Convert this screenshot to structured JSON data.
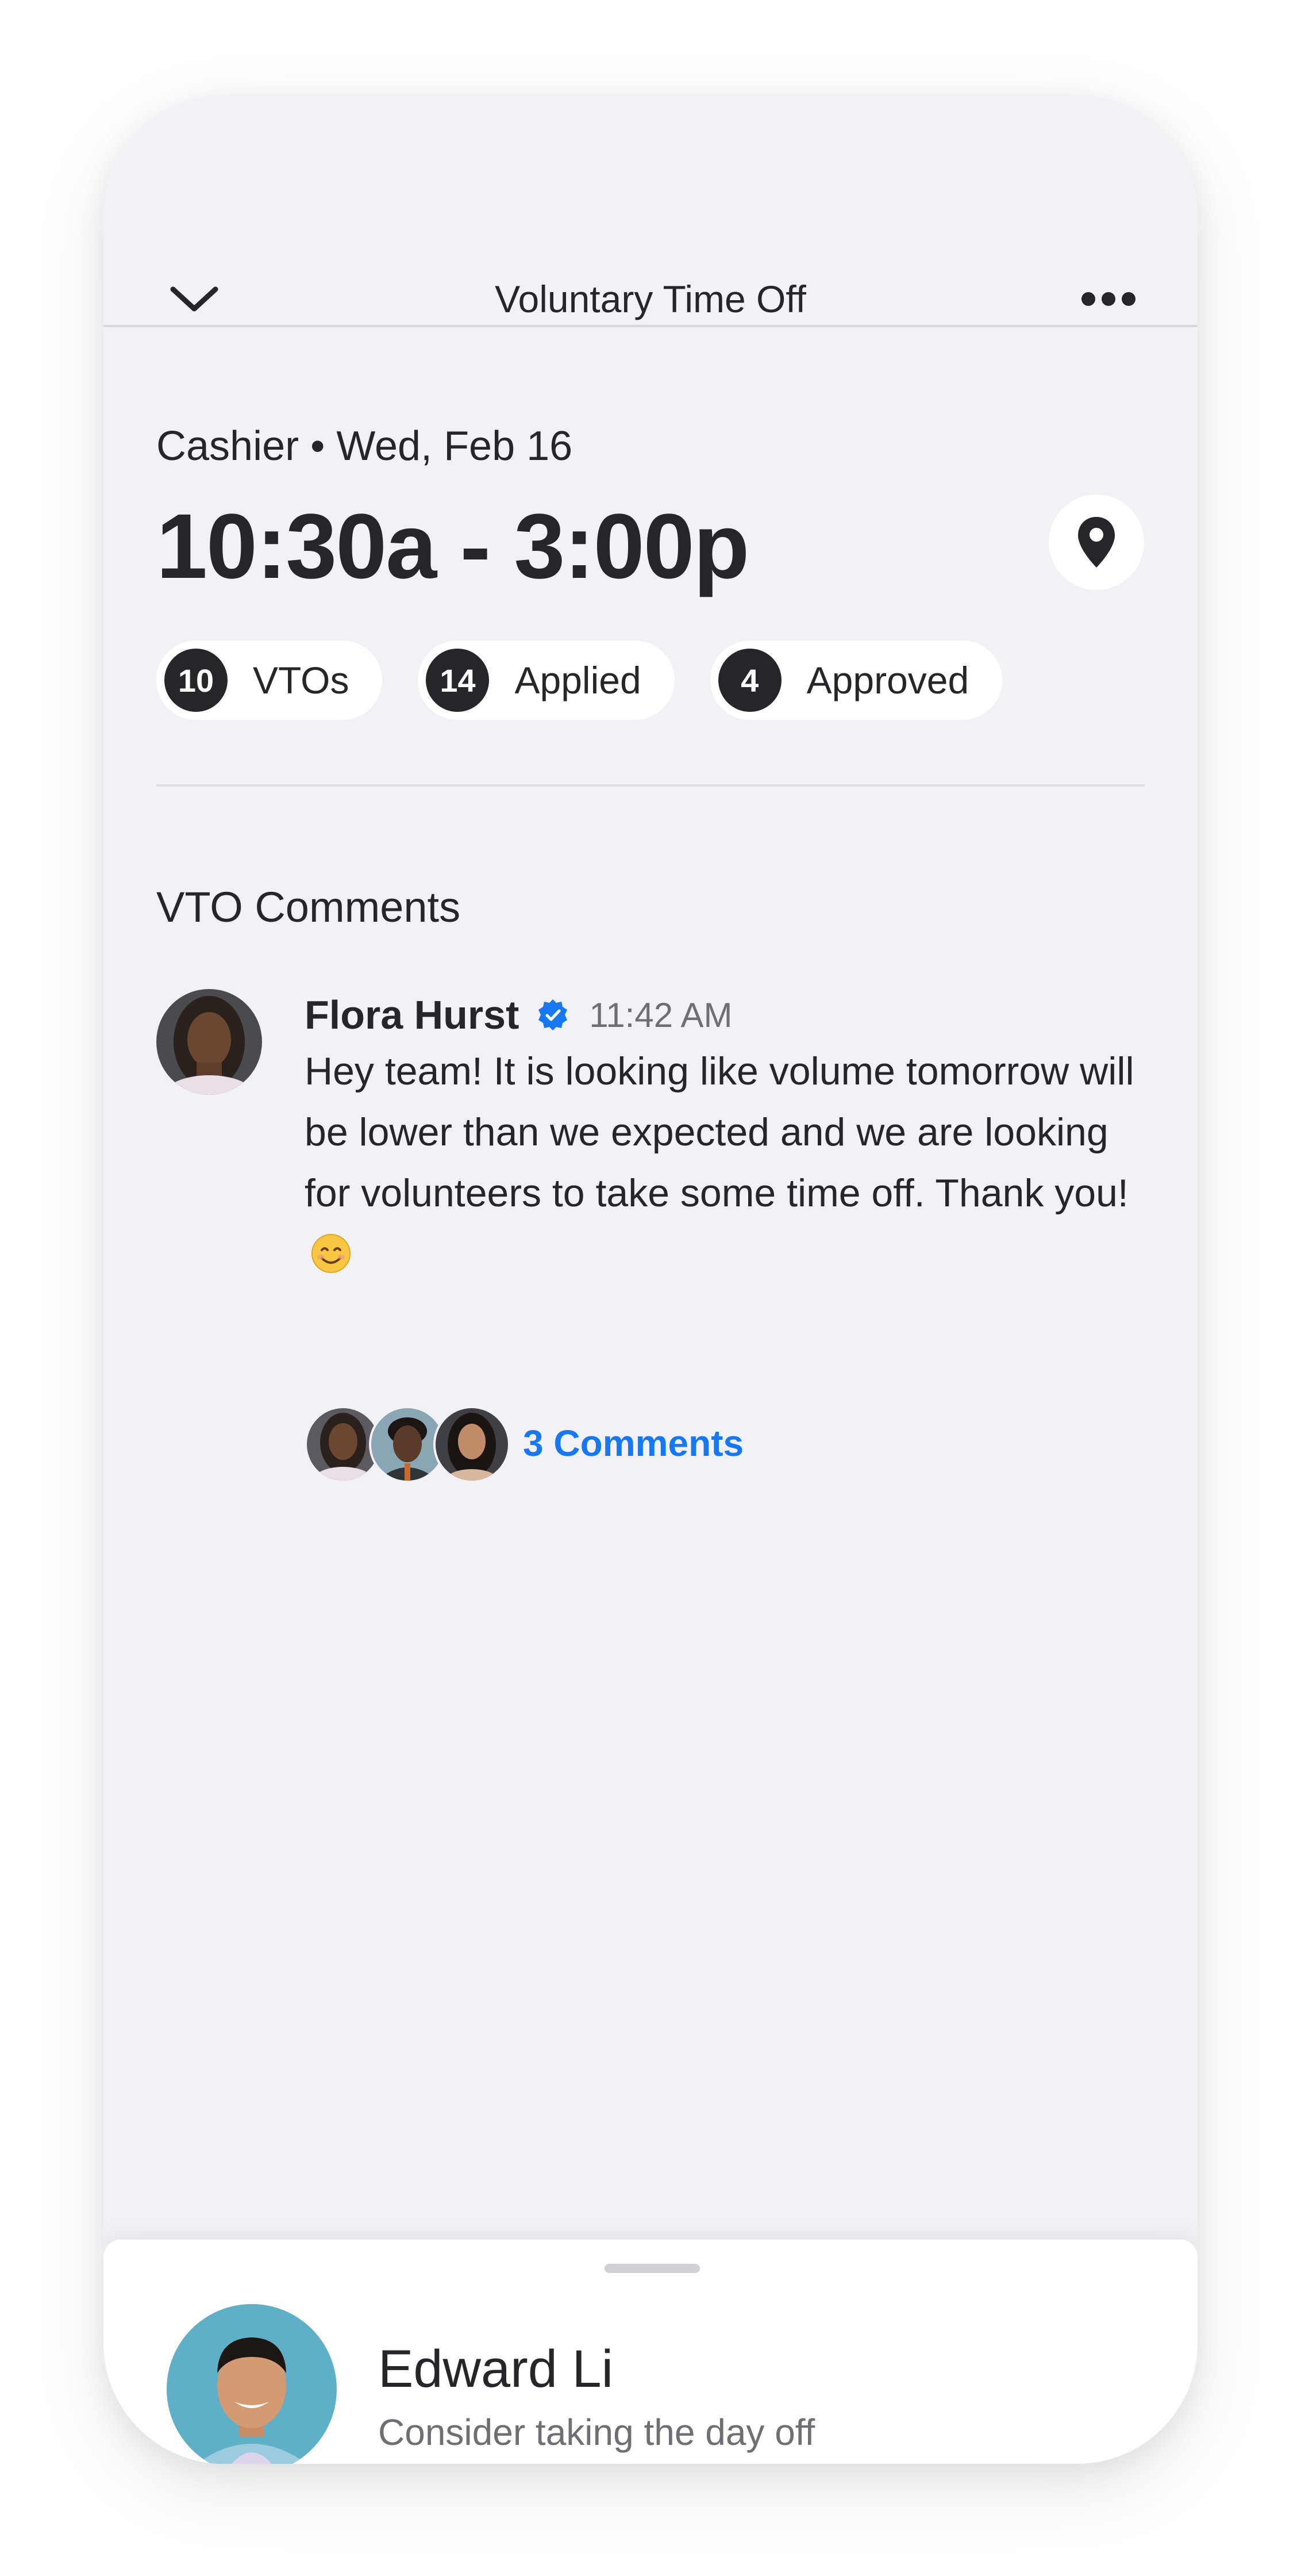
{
  "header": {
    "title": "Voluntary Time Off",
    "back_icon": "chevron-down-icon",
    "more_icon": "more-horizontal-icon"
  },
  "shift": {
    "role_date": "Cashier • Wed, Feb 16",
    "time_range": "10:30a - 3:00p",
    "location_icon": "map-pin-icon"
  },
  "stats": [
    {
      "count": "10",
      "label": "VTOs"
    },
    {
      "count": "14",
      "label": "Applied"
    },
    {
      "count": "4",
      "label": "Approved"
    }
  ],
  "comments": {
    "section_title": "VTO Comments",
    "author": "Flora Hurst",
    "time": "11:42 AM",
    "body": "Hey team! It is looking like volume tomorrow will be lower than we expected and we are looking for volunteers to take some time off. Thank you!",
    "replies_label": "3 Comments",
    "verified_icon": "verified-badge-icon",
    "emoji_icon": "smiling-face-emoji"
  },
  "notification": {
    "name": "Edward Li",
    "message": "Consider taking the day off"
  },
  "colors": {
    "background": "#f2f2f6",
    "text": "#262529",
    "accent": "#1778f2",
    "muted": "#6e6e75"
  }
}
